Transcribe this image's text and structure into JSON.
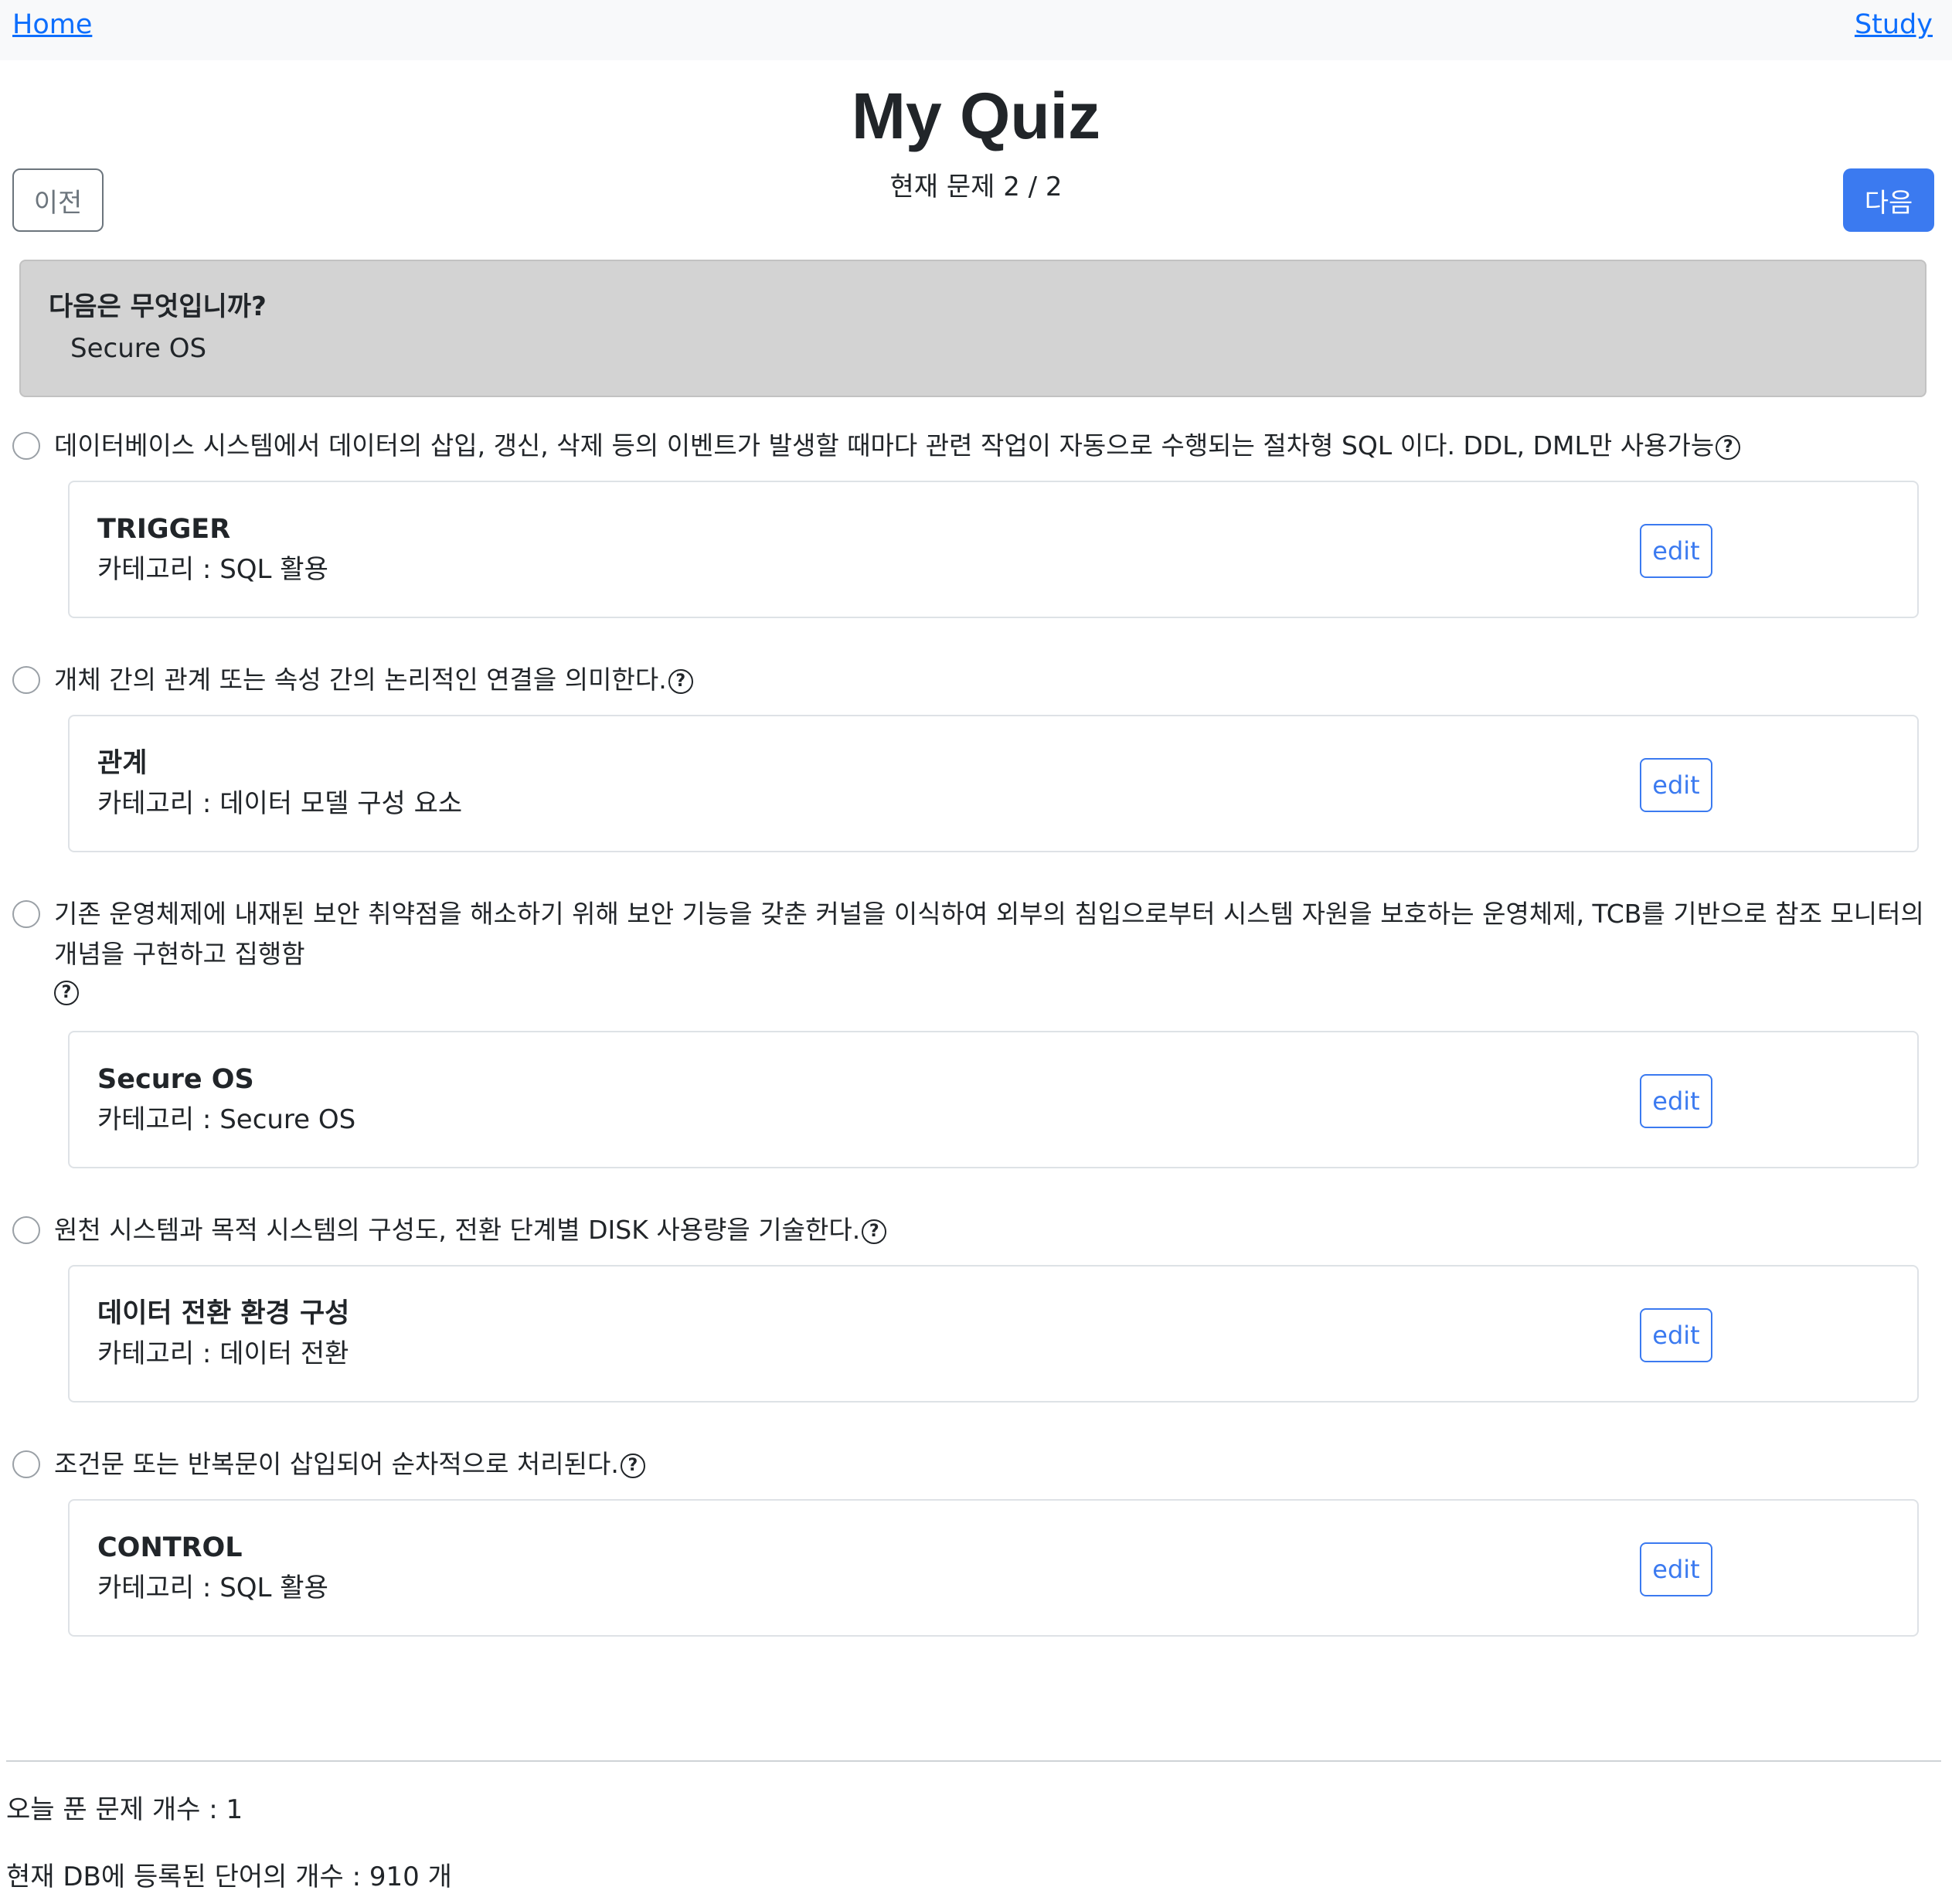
{
  "nav": {
    "home": "Home",
    "study": "Study"
  },
  "title": "My Quiz",
  "progress": "현재 문제 2 / 2",
  "buttons": {
    "prev": "이전",
    "next": "다음",
    "edit": "edit"
  },
  "question": {
    "prompt": "다음은 무엇입니까?",
    "word": "Secure OS"
  },
  "options": [
    {
      "text": "데이터베이스 시스템에서 데이터의 삽입, 갱신, 삭제 등의 이벤트가 발생할 때마다 관련 작업이 자동으로 수행되는 절차형 SQL 이다. DDL, DML만 사용가능",
      "card": {
        "title": "TRIGGER",
        "category": "카테고리 : SQL 활용"
      }
    },
    {
      "text": "개체 간의 관계 또는 속성 간의 논리적인 연결을 의미한다.",
      "card": {
        "title": "관계",
        "category": "카테고리 : 데이터 모델 구성 요소"
      }
    },
    {
      "text": "기존 운영체제에 내재된 보안 취약점을 해소하기 위해 보안 기능을 갖춘 커널을 이식하여 외부의 침입으로부터 시스템 자원을 보호하는 운영체제, TCB를 기반으로 참조 모니터의 개념을 구현하고 집행함",
      "card": {
        "title": "Secure OS",
        "category": "카테고리 : Secure OS"
      }
    },
    {
      "text": "원천 시스템과 목적 시스템의 구성도, 전환 단계별 DISK 사용량을 기술한다.",
      "card": {
        "title": "데이터 전환 환경 구성",
        "category": "카테고리 : 데이터 전환"
      }
    },
    {
      "text": "조건문 또는 반복문이 삽입되어 순차적으로 처리된다.",
      "card": {
        "title": "CONTROL",
        "category": "카테고리 : SQL 활용"
      }
    }
  ],
  "icons": {
    "help": "question-circle-icon",
    "help_glyph": "?"
  },
  "footer": {
    "solved_today": "오늘 푼 문제 개수 : 1",
    "db_count": "현재 DB에 등록된 단어의 개수 : 910 개"
  },
  "colors": {
    "primary": "#3b7af0",
    "question_bg": "#d3d3d3",
    "link": "#0d6efd"
  }
}
